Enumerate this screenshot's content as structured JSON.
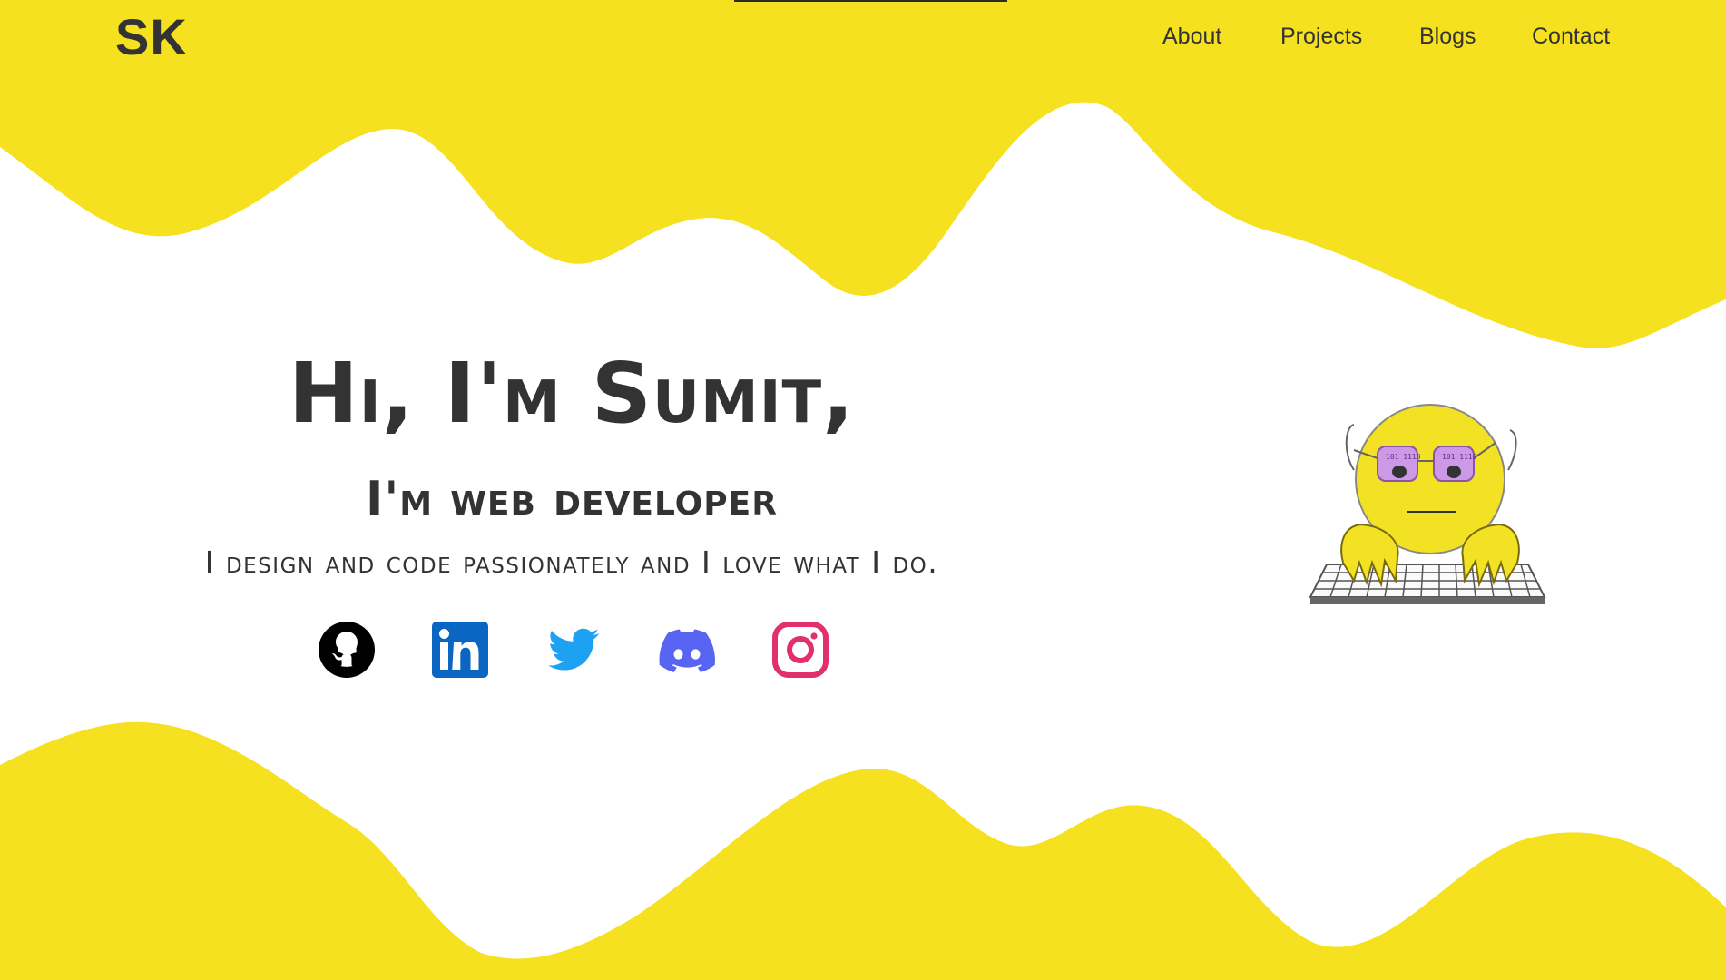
{
  "header": {
    "logo": "SK",
    "nav": [
      {
        "label": "About"
      },
      {
        "label": "Projects"
      },
      {
        "label": "Blogs"
      },
      {
        "label": "Contact"
      }
    ]
  },
  "hero": {
    "headline": "Hi, I'm Sumit,",
    "subheadline": "I'm web developer",
    "tagline": "I design and code passionately and I love what I do."
  },
  "socials": [
    {
      "icon": "github-icon",
      "color": "#000000"
    },
    {
      "icon": "linkedin-icon",
      "color": "#0a66c2"
    },
    {
      "icon": "twitter-icon",
      "color": "#1da1f2"
    },
    {
      "icon": "discord-icon",
      "color": "#5865f2"
    },
    {
      "icon": "instagram-icon",
      "color": "#e1306c"
    }
  ],
  "avatar": {
    "icon": "coder-emoji-illustration",
    "glyphs": "101 1110"
  },
  "colors": {
    "accent": "#f5e11f",
    "text": "#333333",
    "background": "#ffffff"
  }
}
